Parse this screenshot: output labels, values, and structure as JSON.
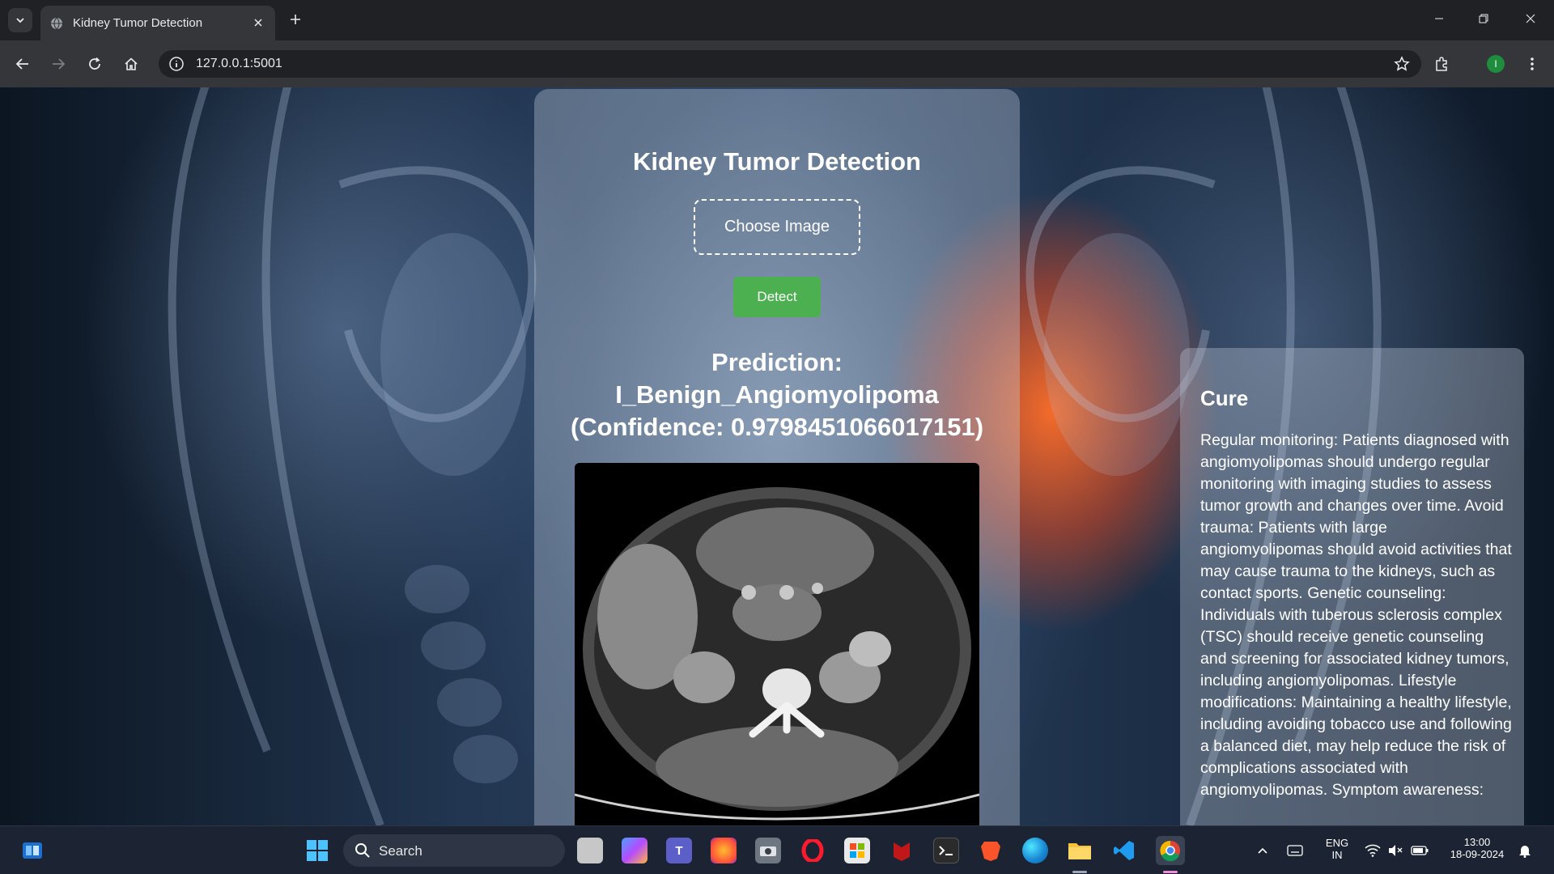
{
  "browser": {
    "tab_title": "Kidney Tumor Detection",
    "url": "127.0.0.1:5001",
    "profile_initial": "I"
  },
  "app": {
    "title": "Kidney Tumor Detection",
    "choose_label": "Choose Image",
    "detect_label": "Detect",
    "prediction_line1": "Prediction:",
    "prediction_line2": "I_Benign_Angiomyolipoma",
    "prediction_line3": "(Confidence: 0.9798451066017151)",
    "cure_heading": "Cure",
    "cure_text": "Regular monitoring: Patients diagnosed with angiomyolipomas should undergo regular monitoring with imaging studies to assess tumor growth and changes over time. Avoid trauma: Patients with large angiomyolipomas should avoid activities that may cause trauma to the kidneys, such as contact sports. Genetic counseling: Individuals with tuberous sclerosis complex (TSC) should receive genetic counseling and screening for associated kidney tumors, including angiomyolipomas. Lifestyle modifications: Maintaining a healthy lifestyle, including avoiding tobacco use and following a balanced diet, may help reduce the risk of complications associated with angiomyolipomas. Symptom awareness:"
  },
  "taskbar": {
    "search_label": "Search",
    "lang_line1": "ENG",
    "lang_line2": "IN",
    "time": "13:00",
    "date": "18-09-2024",
    "apps": [
      "windows-start",
      "file-manager",
      "copilot",
      "teams",
      "firefox",
      "camera",
      "opera",
      "store",
      "mcafee",
      "terminal",
      "brave",
      "edge",
      "file-explorer",
      "vscode",
      "chrome"
    ]
  },
  "colors": {
    "detect_button": "#4caf50",
    "chrome_dark": "#202124",
    "chrome_toolbar": "#35363a",
    "taskbar": "#1c2433"
  }
}
